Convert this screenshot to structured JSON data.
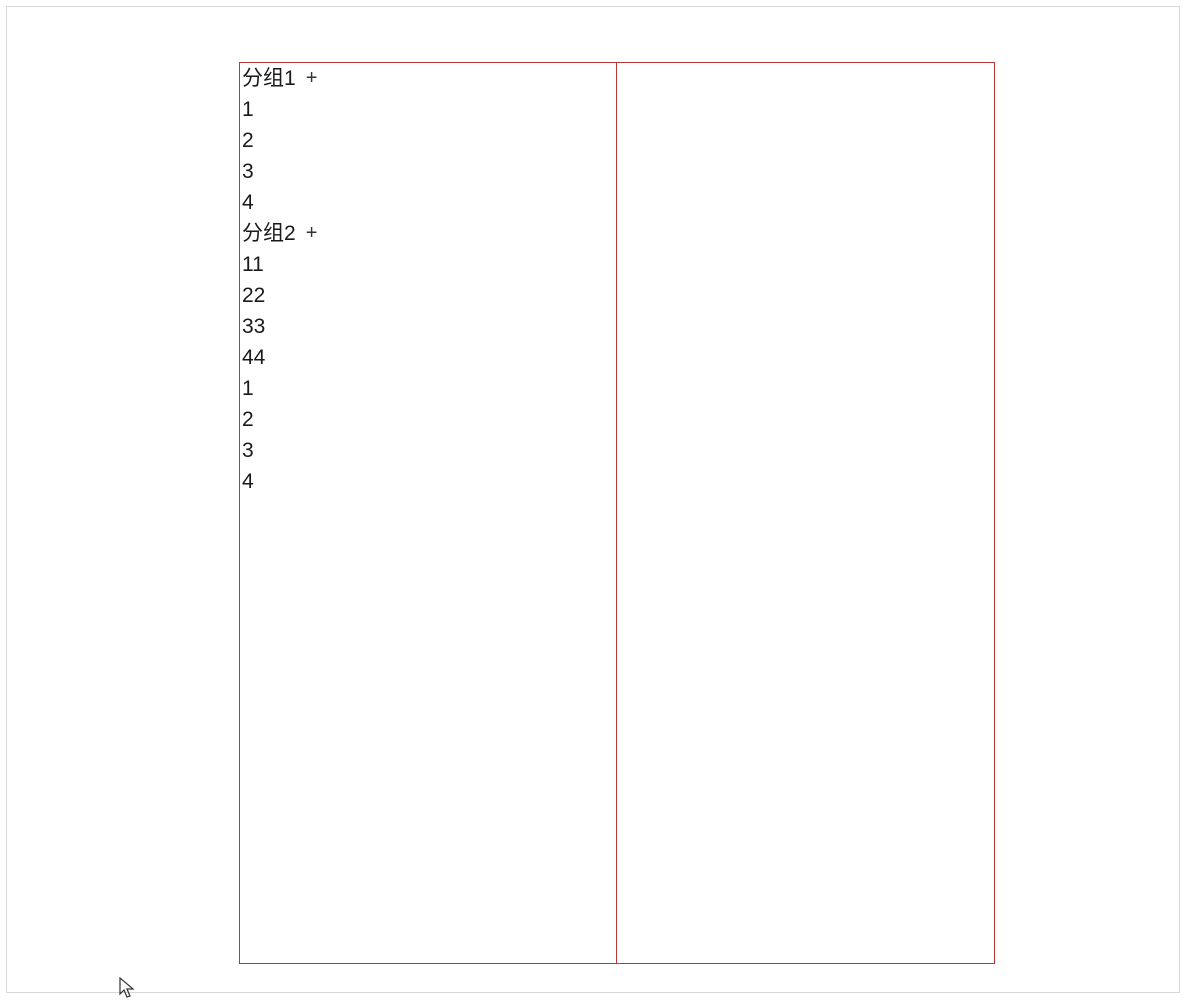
{
  "groups": [
    {
      "label": "分组1",
      "plus": "+",
      "items": [
        "1",
        "2",
        "3",
        "4"
      ]
    },
    {
      "label": "分组2",
      "plus": "+",
      "items": [
        "11",
        "22",
        "33",
        "44",
        "1",
        "2",
        "3",
        "4"
      ]
    }
  ]
}
